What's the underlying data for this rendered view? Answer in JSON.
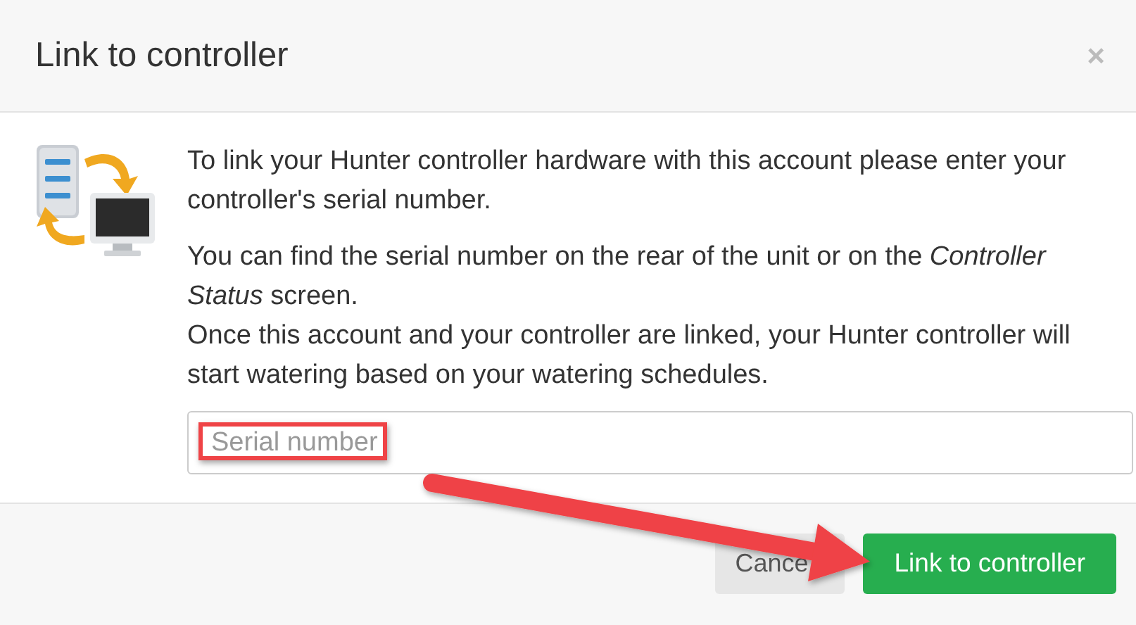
{
  "dialog": {
    "title": "Link to controller",
    "close": "×"
  },
  "body": {
    "paragraphs": [
      "To link your Hunter controller hardware with this account please enter your controller's serial number.",
      "You can find the serial number on the rear of the unit or on the *Controller Status* screen.",
      "Once this account and your controller are linked, your Hunter controller will start watering based on your watering schedules."
    ],
    "serial_field": {
      "placeholder": "Serial number"
    }
  },
  "footer": {
    "buttons": [
      {
        "label": "Cance",
        "kind": "secondary"
      },
      {
        "label": "Link to controller",
        "kind": "primary"
      }
    ]
  },
  "annotations": {
    "highlight_box": true,
    "arrow": true
  }
}
